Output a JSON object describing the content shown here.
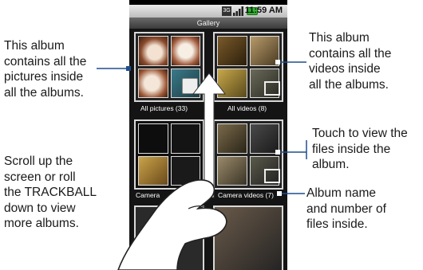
{
  "status_bar": {
    "time": "11:59 AM",
    "network": "3G"
  },
  "app_bar": {
    "title": "Gallery"
  },
  "albums": [
    {
      "label": "All pictures (33)"
    },
    {
      "label": "All videos (8)"
    },
    {
      "label": "Camera"
    },
    {
      "label": "Camera videos (7)"
    }
  ],
  "annotations": {
    "left_top": [
      "This album",
      "contains all the",
      "pictures inside",
      "all the albums."
    ],
    "left_bottom": [
      "Scroll up the",
      "screen or roll",
      "the TRACKBALL",
      "down to view",
      "more albums."
    ],
    "right_top": [
      "This album",
      "contains all the",
      "videos inside",
      "all the albums."
    ],
    "right_middle": [
      "Touch to view the",
      "files inside the",
      "album."
    ],
    "right_bottom": [
      "Album name",
      "and number of",
      "files inside."
    ]
  },
  "colors": {
    "line": "#1f4f8e",
    "screen_bg": "#141414"
  }
}
